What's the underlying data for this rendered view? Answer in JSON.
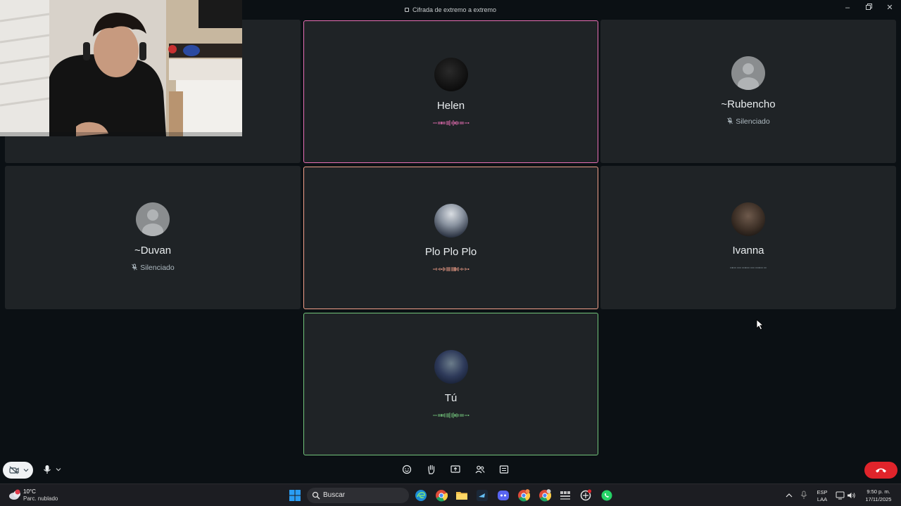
{
  "window": {
    "title": "Cifrada de extremo a extremo",
    "controls": [
      "minimize",
      "restore",
      "close"
    ]
  },
  "participants": [
    {
      "name": "Helen",
      "status": "speaking",
      "avatar": "photo",
      "speaking_color": "#e86fb5"
    },
    {
      "name": "~Rubencho",
      "status": "Silenciado",
      "avatar": "placeholder"
    },
    {
      "name": "~Duvan",
      "status": "Silenciado",
      "avatar": "placeholder"
    },
    {
      "name": "Plo Plo Plo",
      "status": "speaking",
      "avatar": "photo",
      "speaking_color": "#f2a08a"
    },
    {
      "name": "Ivanna",
      "status": "idle",
      "avatar": "photo"
    },
    {
      "name": "Tú",
      "status": "speaking",
      "avatar": "photo",
      "speaking_color": "#72c57b"
    }
  ],
  "call_controls": {
    "camera": "camera-off-icon",
    "microphone": "mic-icon",
    "center": [
      "emoji-icon",
      "raise-hand-icon",
      "screen-share-icon",
      "participants-icon",
      "more-options-icon"
    ],
    "end_call": "end-call-icon",
    "end_call_color": "#e0242b"
  },
  "taskbar": {
    "weather": {
      "temp": "10°C",
      "desc": "Parc. nublado"
    },
    "search_placeholder": "Buscar",
    "language": {
      "line1": "ESP",
      "line2": "LAA"
    },
    "clock": {
      "time": "9:50 p. m.",
      "date": "17/11/2025"
    },
    "apps": [
      "windows-start-icon",
      "edge-icon",
      "chrome-icon",
      "file-explorer-icon",
      "steam-icon",
      "discord-icon",
      "chrome-profile-icon",
      "chrome-profile-2-icon",
      "widget-icon",
      "openai-icon",
      "whatsapp-icon"
    ]
  }
}
